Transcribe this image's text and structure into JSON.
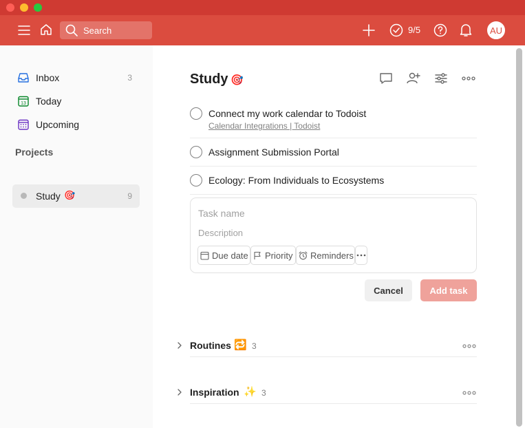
{
  "topbar": {
    "search_placeholder": "Search",
    "karma_count": "9/5",
    "avatar_initials": "AU",
    "brand_color": "#db4c3f"
  },
  "sidebar": {
    "items": [
      {
        "label": "Inbox",
        "count": "3"
      },
      {
        "label": "Today",
        "count": ""
      },
      {
        "label": "Upcoming",
        "count": ""
      }
    ],
    "projects_title": "Projects",
    "projects": [
      {
        "label": "Study",
        "count": "9"
      }
    ]
  },
  "main": {
    "title": "Study",
    "tasks": [
      {
        "title": "Connect my work calendar to Todoist",
        "link": "Calendar Integrations | Todoist"
      },
      {
        "title": "Assignment Submission Portal"
      },
      {
        "title": "Ecology: From Individuals to Ecosystems"
      }
    ],
    "editor": {
      "name_placeholder": "Task name",
      "description_placeholder": "Description",
      "due_date_label": "Due date",
      "priority_label": "Priority",
      "reminders_label": "Reminders"
    },
    "cancel_label": "Cancel",
    "add_task_label": "Add task",
    "sections": [
      {
        "title": "Routines",
        "emoji": "🔁",
        "count": "3"
      },
      {
        "title": "Inspiration",
        "emoji": "✨",
        "count": "3"
      }
    ]
  }
}
